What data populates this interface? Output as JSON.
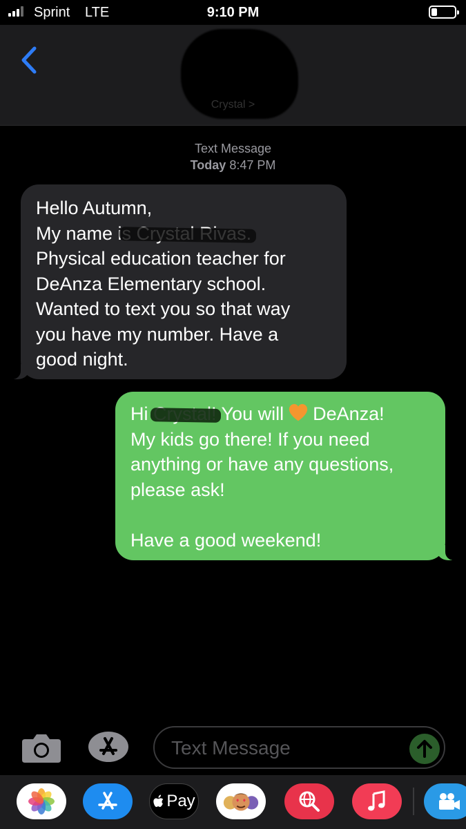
{
  "status_bar": {
    "carrier": "Sprint",
    "network": "LTE",
    "time": "9:10 PM"
  },
  "header": {
    "contact_name": "Crystal >"
  },
  "thread": {
    "service": "Text Message",
    "timestamp_day": "Today",
    "timestamp_time": "8:47 PM"
  },
  "messages": {
    "incoming": {
      "line1": "Hello Autumn,",
      "line2_a": "My name i",
      "line2_b": "s Crystal Rivas.",
      "line3_a": "Physical education",
      "line3_b": " teacher for",
      "line4": "DeAnza Elementary school.",
      "line5": "Wanted to text you so that way",
      "line6": "you have my number. Have a",
      "line7": "good night."
    },
    "outgoing": {
      "line1_a": "Hi ",
      "line1_b": "Crystal!",
      "line1_c": " You will",
      "line1_d": "DeAnza!",
      "line2": "My kids go there! If you need",
      "line3": "anything or have any questions,",
      "line4": "please ask!",
      "line6": "Have a good weekend!"
    }
  },
  "input_bar": {
    "placeholder": "Text Message"
  },
  "app_drawer": {
    "apple_pay_label": "Pay"
  },
  "colors": {
    "incoming_bubble": "#262629",
    "outgoing_bubble": "#63c662",
    "accent_blue": "#2e7cf6"
  }
}
